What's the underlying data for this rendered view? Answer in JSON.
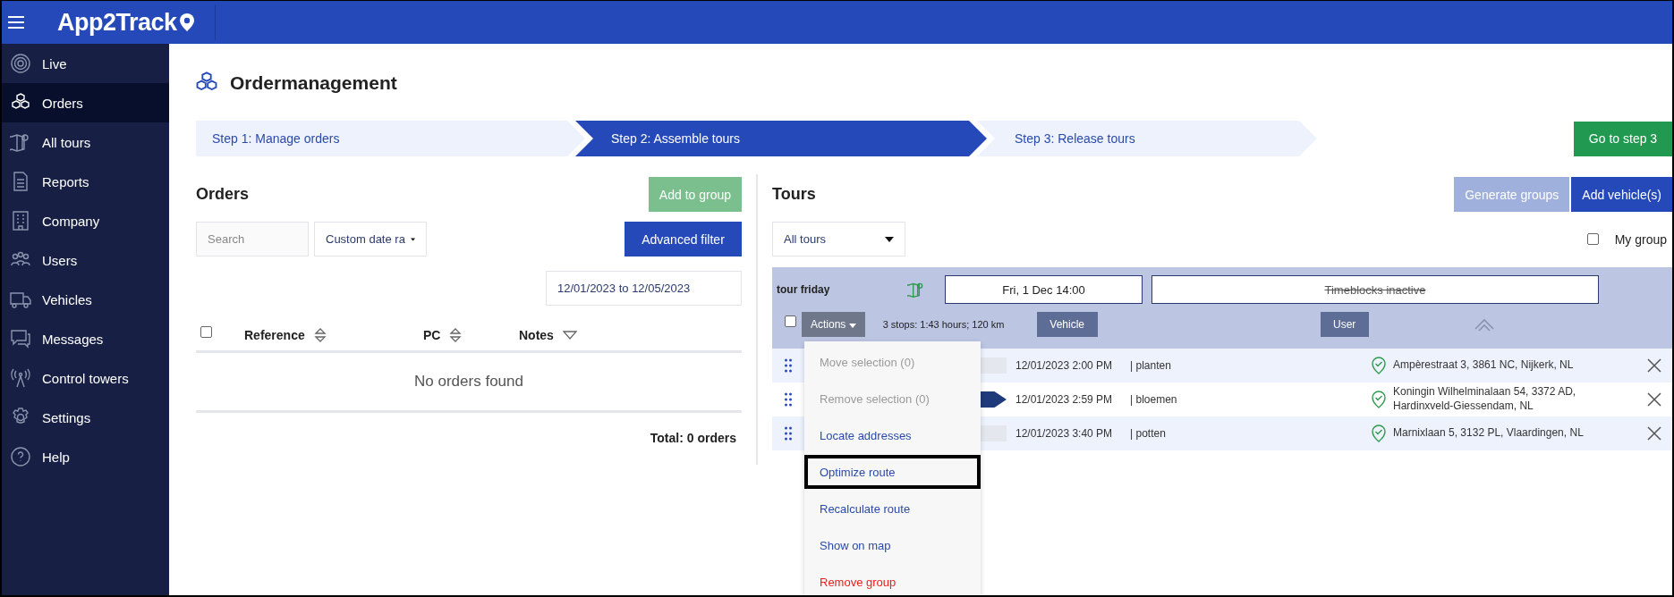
{
  "topbar": {
    "logo": "App2Track"
  },
  "sidebar": {
    "items": [
      {
        "label": "Live",
        "selected": false
      },
      {
        "label": "Orders",
        "selected": true
      },
      {
        "label": "All tours",
        "selected": false
      },
      {
        "label": "Reports",
        "selected": false
      },
      {
        "label": "Company",
        "selected": false
      },
      {
        "label": "Users",
        "selected": false
      },
      {
        "label": "Vehicles",
        "selected": false
      },
      {
        "label": "Messages",
        "selected": false
      },
      {
        "label": "Control towers",
        "selected": false
      },
      {
        "label": "Settings",
        "selected": false
      },
      {
        "label": "Help",
        "selected": false
      }
    ]
  },
  "page": {
    "title": "Ordermanagement"
  },
  "steps": [
    {
      "label": "Step 1: Manage orders",
      "selected": false
    },
    {
      "label": "Step 2: Assemble tours",
      "selected": true
    },
    {
      "label": "Step 3: Release tours",
      "selected": false
    }
  ],
  "next_button": "Go to step 3",
  "orders": {
    "title": "Orders",
    "add_button": {
      "label": "Add to group",
      "disabled": true
    },
    "search": {
      "placeholder": "Search"
    },
    "date_select": "Custom date ra",
    "filter_button": "Advanced filter",
    "date_range": "12/01/2023 to 12/05/2023",
    "select_all": {
      "checked": false
    },
    "columns": [
      {
        "label": "Reference",
        "kind": "sort"
      },
      {
        "label": "PC",
        "kind": "sort"
      },
      {
        "label": "Notes",
        "kind": "filter"
      }
    ],
    "empty": "No orders found",
    "total": "Total: 0 orders"
  },
  "tours": {
    "title": "Tours",
    "generate_button": {
      "label": "Generate groups",
      "disabled": true
    },
    "add_button": "Add vehicle(s)",
    "filter_select": "All tours",
    "my_groups": {
      "label": "My group",
      "checked": false
    },
    "tour": {
      "name": "tour friday",
      "start": "Fri, 1 Dec 14:00",
      "timeblocks": {
        "label": "Timeblocks inactive",
        "active": false
      },
      "select": {
        "checked": false
      },
      "actions": {
        "label": "Actions",
        "expanded": true
      },
      "stats": "3 stops: 1:43 hours; 120 km",
      "vehicle_button": "Vehicle",
      "user_button": "User",
      "expanded": true,
      "stops": [
        {
          "kind": "plain",
          "time": "12/01/2023 2:00 PM",
          "note": "| planten",
          "located": true,
          "address": "Ampèrestraat 3, 3861 NC, Nijkerk, NL"
        },
        {
          "kind": "arrow",
          "time": "12/01/2023 2:59 PM",
          "note": "| bloemen",
          "located": true,
          "address": "Koningin Wilhelminalaan 54, 3372 AD, Hardinxveld-Giessendam, NL"
        },
        {
          "kind": "plain",
          "time": "12/01/2023 3:40 PM",
          "note": "| potten",
          "located": true,
          "address": "Marnixlaan 5, 3132 PL, Vlaardingen, NL"
        }
      ]
    },
    "menu": [
      {
        "label": "Move selection (0)",
        "kind": "disabled",
        "selected": false
      },
      {
        "label": "Remove selection (0)",
        "kind": "disabled",
        "selected": false
      },
      {
        "label": "Locate addresses",
        "kind": "action",
        "selected": false
      },
      {
        "label": "Optimize route",
        "kind": "action",
        "selected": true
      },
      {
        "label": "Recalculate route",
        "kind": "action",
        "selected": false
      },
      {
        "label": "Show on map",
        "kind": "action",
        "selected": false
      },
      {
        "label": "Remove group",
        "kind": "danger",
        "selected": false
      }
    ]
  }
}
